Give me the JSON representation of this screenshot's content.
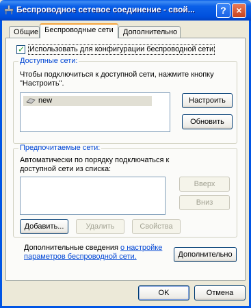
{
  "window": {
    "title": "Беспроводное сетевое соединение - свой...",
    "help_button": "?",
    "close_button": "×"
  },
  "tabs": [
    {
      "label": "Общие"
    },
    {
      "label": "Беспроводные сети",
      "active": true
    },
    {
      "label": "Дополнительно"
    }
  ],
  "use_windows_checkbox": {
    "label": "Использовать для конфигурации беспроводной сети",
    "checked": true
  },
  "available_networks": {
    "title": "Доступные сети:",
    "description": "Чтобы подключиться к доступной сети, нажмите кнопку \"Настроить\".",
    "items": [
      {
        "label": "new",
        "icon": "wireless-network-icon"
      }
    ],
    "configure_button": "Настроить",
    "refresh_button": "Обновить"
  },
  "preferred_networks": {
    "title": "Предпочитаемые сети:",
    "description": "Автоматически по порядку подключаться к доступной сети из списка:",
    "up_button": "Вверх",
    "down_button": "Вниз",
    "add_button": "Добавить...",
    "remove_button": "Удалить",
    "properties_button": "Свойства"
  },
  "more_info": {
    "text_before": "Дополнительные сведения",
    "link_line1": "о настройке",
    "link_line2": "параметров беспроводной сети.",
    "advanced_button": "Дополнительно"
  },
  "footer": {
    "ok_button": "OK",
    "cancel_button": "Отмена"
  },
  "colors": {
    "titlebar": "#0054e3",
    "face": "#ece9d8",
    "group_title": "#0046d5",
    "tab_highlight": "#f6a43c"
  }
}
